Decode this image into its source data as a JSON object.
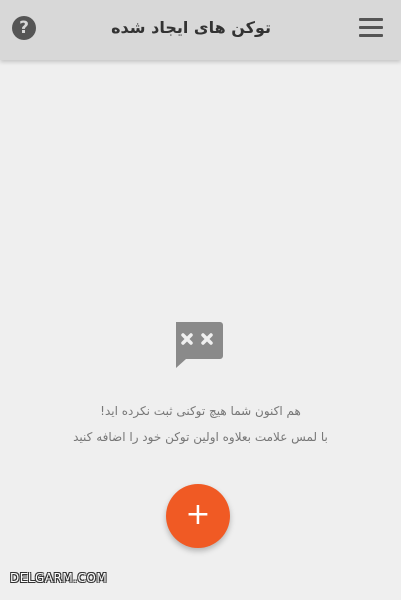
{
  "app_bar": {
    "title": "توکن های ایجاد شده",
    "help_glyph": "?",
    "help_icon": "question-circle-icon",
    "menu_icon": "hamburger-menu-icon",
    "background": "#d8d8d8"
  },
  "empty_state": {
    "icon": "message-x-icon",
    "line1": "هم اکنون شما هیچ توکنی ثبت نکرده اید!",
    "line2": "با لمس علامت بعلاوه اولین توکن خود را اضافه کنید"
  },
  "fab": {
    "glyph": "+",
    "icon": "plus-icon",
    "color": "#f05a24"
  },
  "watermark": {
    "text": "DELGARM.COM"
  }
}
